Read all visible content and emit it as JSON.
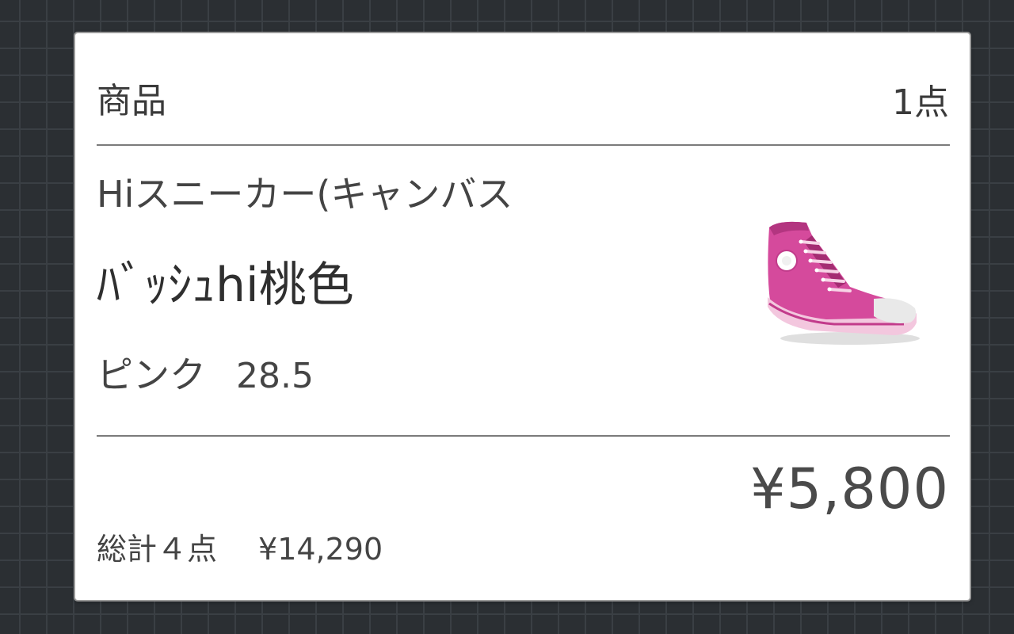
{
  "header": {
    "title": "商品",
    "count": "1点"
  },
  "product": {
    "name_line1": "Hiスニーカー(キャンバス",
    "name_line2": "ﾊﾞｯｼｭhi桃色",
    "color": "ピンク",
    "size": "28.5",
    "image_icon": "sneaker-icon",
    "price": "¥5,800"
  },
  "summary": {
    "total_label": "総計４点",
    "total_amount": "¥14,290"
  },
  "colors": {
    "background": "#2b2f33",
    "card": "#ffffff",
    "text": "#333333",
    "shoe_pink": "#d9489e"
  }
}
